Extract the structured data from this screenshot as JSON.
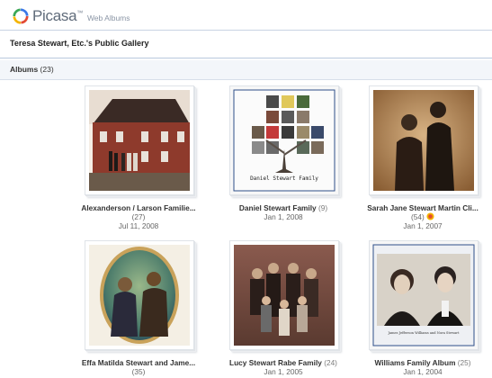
{
  "brand": {
    "name": "Picasa",
    "tm": "™",
    "section": "Web Albums"
  },
  "gallery": {
    "title": "Teresa Stewart, Etc.'s Public Gallery"
  },
  "albums_bar": {
    "label": "Albums",
    "count": "(23)"
  },
  "albums": [
    {
      "title": "Alexanderson / Larson Familie...",
      "count": "(27)",
      "date": "Jul 11, 2008"
    },
    {
      "title": "Daniel Stewart Family",
      "count": "(9)",
      "date": "Jan 1, 2008"
    },
    {
      "title": "Sarah Jane Stewart Martin Cli...",
      "count": "(54)",
      "date": "Jan 1, 2007"
    },
    {
      "title": "Effa Matilda Stewart and Jame...",
      "count": "(35)",
      "date": ""
    },
    {
      "title": "Lucy Stewart Rabe Family",
      "count": "(24)",
      "date": "Jan 1, 2005"
    },
    {
      "title": "Williams Family Album",
      "count": "(25)",
      "date": "Jan 1, 2004"
    }
  ],
  "thumb_texts": {
    "daniel_caption": "Daniel Stewart Family",
    "williams_caption": "James Jefferson Williams and Nora Stewart"
  },
  "colors": {
    "logo_red": "#e24a33",
    "logo_yellow": "#f4b400",
    "logo_green": "#3aa757",
    "logo_blue": "#3b78e7"
  }
}
